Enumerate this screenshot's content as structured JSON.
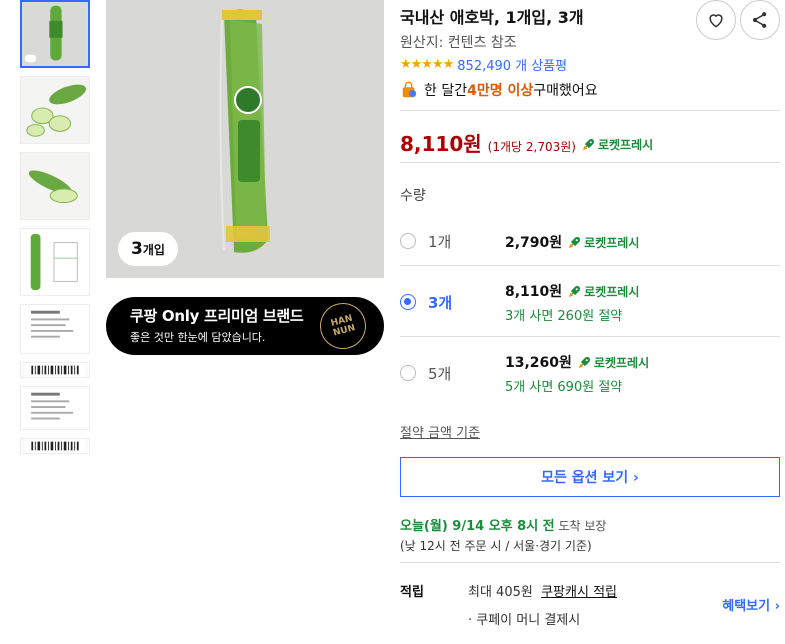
{
  "gallery": {
    "thumbnails": [
      "product-pack",
      "sliced-zucchini",
      "whole-zucchini",
      "package-diagram",
      "label-text",
      "barcode",
      "label-text-2",
      "barcode-2"
    ],
    "pack_badge_number": "3",
    "pack_badge_unit": "개입"
  },
  "brand_banner": {
    "title": "쿠팡 Only 프리미엄 브랜드",
    "subtitle": "좋은 것만 한눈에 담았습니다.",
    "logo_line1": "HAN",
    "logo_line2": "NUN"
  },
  "product": {
    "title": "국내산 애호박, 1개입, 3개",
    "origin": "원산지: 컨텐츠 참조",
    "stars": "★★★★★",
    "review_count": "852,490 개 상품평",
    "buyers_prefix": "한 달간 ",
    "buyers_highlight": "4만명 이상",
    "buyers_suffix": " 구매했어요"
  },
  "price": {
    "main": "8,110원",
    "unit": "(1개당 2,703원)",
    "badge": "로켓프레시"
  },
  "quantity": {
    "label": "수량",
    "options": [
      {
        "name": "1개",
        "price": "2,790원",
        "badge": "로켓프레시",
        "save": "",
        "selected": false
      },
      {
        "name": "3개",
        "price": "8,110원",
        "badge": "로켓프레시",
        "save": "3개 사면 260원 절약",
        "selected": true
      },
      {
        "name": "5개",
        "price": "13,260원",
        "badge": "로켓프레시",
        "save": "5개 사면 690원 절약",
        "selected": false
      }
    ],
    "savings_link": "절약 금액 기준",
    "all_options": "모든 옵션 보기 ›"
  },
  "delivery": {
    "arrival": "오늘(월) 9/14 오후 8시 전",
    "arrival_suffix": " 도착 보장",
    "note": "(낮 12시 전 주문 시 / 서울·경기 기준)"
  },
  "rewards": {
    "label": "적립",
    "max": "최대 405원",
    "cash": "쿠팡캐시 적립",
    "pay": "· 쿠페이 머니 결제시",
    "benefit": "혜택보기 ›"
  },
  "colors": {
    "accent_blue": "#346aff",
    "price_red": "#ae0000",
    "rocket_green": "#1a8c3a",
    "highlight_orange": "#e05800"
  }
}
